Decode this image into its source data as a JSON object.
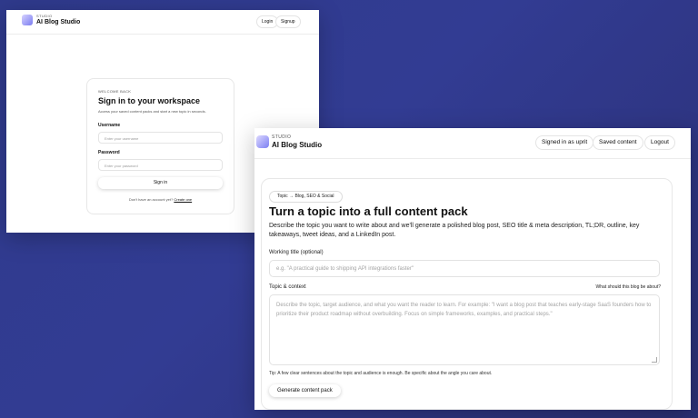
{
  "login_window": {
    "brand": {
      "kicker": "STUDIO",
      "title": "AI Blog Studio"
    },
    "nav": {
      "login": "Login",
      "signup": "Signup"
    },
    "card": {
      "kicker": "WELCOME BACK",
      "title": "Sign in to your workspace",
      "subtitle": "Access your saved content packs and start a new topic in seconds.",
      "username_label": "Username",
      "username_placeholder": "Enter your username",
      "password_label": "Password",
      "password_placeholder": "Enter your password",
      "signin_button": "Sign in",
      "footer_text": "Don't have an account yet?",
      "footer_link": "Create one"
    }
  },
  "main_window": {
    "brand": {
      "kicker": "STUDIO",
      "title": "AI Blog Studio"
    },
    "nav": {
      "signed_in": "Signed in as uprit",
      "saved": "Saved content",
      "logout": "Logout"
    },
    "badge": "Topic → Blog, SEO & Social",
    "title": "Turn a topic into a full content pack",
    "description": "Describe the topic you want to write about and we'll generate a polished blog post, SEO title & meta description, TL;DR, outline, key takeaways, tweet ideas, and a LinkedIn post.",
    "working_title_label": "Working title (optional)",
    "working_title_placeholder": "e.g. \"A practical guide to shipping API integrations faster\"",
    "topic_label": "Topic & context",
    "topic_hint": "What should this blog be about?",
    "topic_placeholder": "Describe the topic, target audience, and what you want the reader to learn. For example: \"I want a blog post that teaches early-stage SaaS founders how to prioritize their product roadmap without overbuilding. Focus on simple frameworks, examples, and practical steps.\"",
    "tip": "Tip: A few clear sentences about the topic and audience is enough. Be specific about the angle you care about.",
    "generate_button": "Generate content pack"
  }
}
